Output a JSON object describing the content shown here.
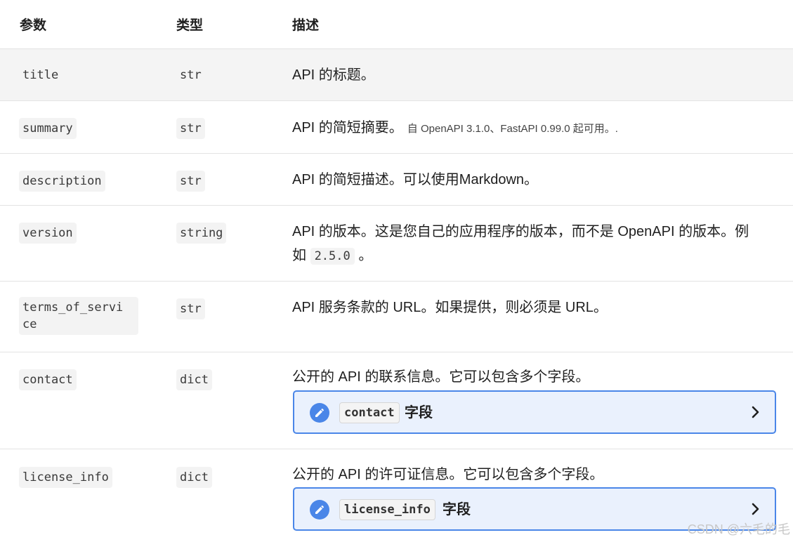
{
  "header": {
    "col_param": "参数",
    "col_type": "类型",
    "col_desc": "描述"
  },
  "rows": [
    {
      "param": "title",
      "type": "str",
      "desc": "API 的标题。"
    },
    {
      "param": "summary",
      "type": "str",
      "desc": "API 的简短摘要。",
      "note": "自 OpenAPI 3.1.0、FastAPI 0.99.0 起可用。."
    },
    {
      "param": "description",
      "type": "str",
      "desc": "API 的简短描述。可以使用Markdown。"
    },
    {
      "param": "version",
      "type": "string",
      "desc_line1": "API 的版本。这是您自己的应用程序的版本，而不是 OpenAPI 的版本。例",
      "desc_line2_pre": "如",
      "desc_code": "2.5.0",
      "desc_line2_post": "。"
    },
    {
      "param_line1": "terms_of_servi",
      "param_line2": "ce",
      "type": "str",
      "desc": "API 服务条款的 URL。如果提供，则必须是 URL。"
    },
    {
      "param": "contact",
      "type": "dict",
      "desc": "公开的 API 的联系信息。它可以包含多个字段。",
      "callout_code": "contact",
      "callout_label": "字段"
    },
    {
      "param": "license_info",
      "type": "dict",
      "desc": "公开的 API 的许可证信息。它可以包含多个字段。",
      "callout_code": "license_info",
      "callout_label": "字段"
    }
  ],
  "watermark": "CSDN @六毛的毛",
  "icons": {
    "callout_icon": "pencil-icon",
    "callout_arrow": "chevron-right-icon"
  },
  "colors": {
    "accent": "#4a86e8",
    "callout_bg": "#eaf1fd",
    "shaded_row": "#f4f4f4"
  }
}
